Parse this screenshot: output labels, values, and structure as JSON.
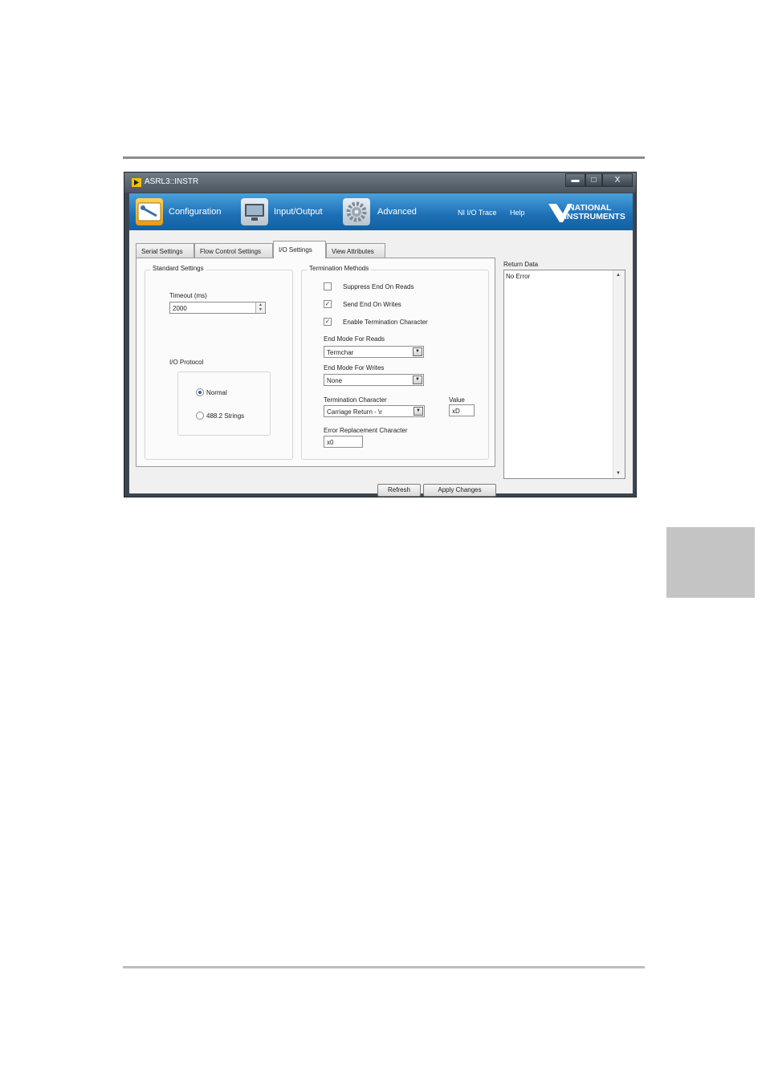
{
  "window": {
    "title": "ASRL3::INSTR",
    "minimize_glyph": "▬",
    "maximize_glyph": "□",
    "close_glyph": "X"
  },
  "navbar": {
    "items": [
      {
        "label": "Configuration",
        "icon": "configuration-icon"
      },
      {
        "label": "Input/Output",
        "icon": "monitor-icon"
      },
      {
        "label": "Advanced",
        "icon": "gear-icon"
      }
    ],
    "trace": "NI I/O Trace",
    "help": "Help",
    "logo_line1": "NATIONAL",
    "logo_line2": "INSTRUMENTS",
    "brand_color": "#1c6fb5"
  },
  "tabs": [
    {
      "label": "Serial Settings",
      "active": false
    },
    {
      "label": "Flow Control Settings",
      "active": false
    },
    {
      "label": "I/O Settings",
      "active": true
    },
    {
      "label": "View Attributes",
      "active": false
    }
  ],
  "standard": {
    "title": "Standard Settings",
    "timeout_label": "Timeout (ms)",
    "timeout_value": "2000",
    "protocol_label": "I/O Protocol",
    "protocol_options": [
      {
        "label": "Normal",
        "selected": true
      },
      {
        "label": "488.2 Strings",
        "selected": false
      }
    ]
  },
  "termination": {
    "title": "Termination Methods",
    "suppress_label": "Suppress End On Reads",
    "suppress_checked": false,
    "send_end_label": "Send End On Writes",
    "send_end_checked": true,
    "enable_term_label": "Enable Termination Character",
    "enable_term_checked": true,
    "check_glyph": "✓",
    "end_mode_reads_label": "End Mode For Reads",
    "end_mode_reads_value": "Termchar",
    "end_mode_writes_label": "End Mode For Writes",
    "end_mode_writes_value": "None",
    "term_char_label": "Termination Character",
    "term_char_value": "Carriage Return - \\r",
    "value_label": "Value",
    "value_value": "xD",
    "error_repl_label": "Error Replacement Character",
    "error_repl_value": "x0",
    "dropdown_glyph": "▼"
  },
  "return_data": {
    "label": "Return Data",
    "value": "No Error"
  },
  "buttons": {
    "refresh": "Refresh",
    "apply": "Apply Changes"
  }
}
